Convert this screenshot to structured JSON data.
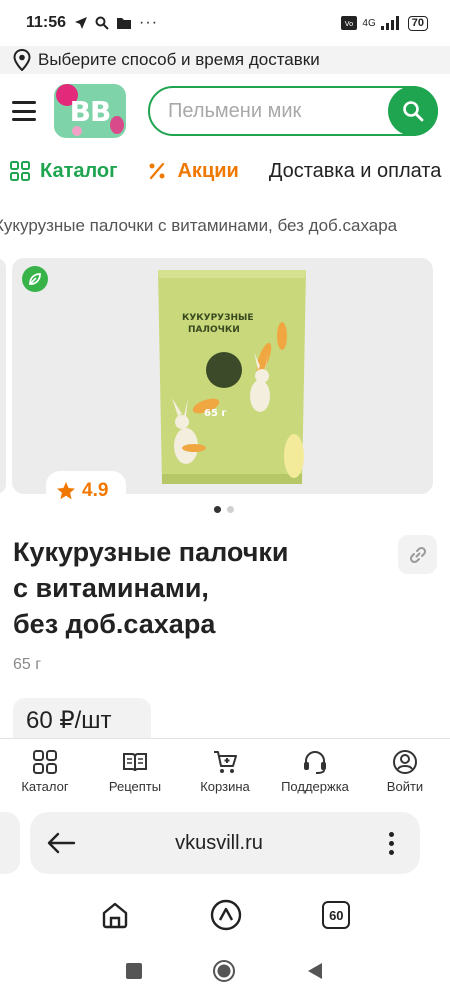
{
  "status_bar": {
    "time": "11:56",
    "network": "4G",
    "battery": "70"
  },
  "delivery_bar": {
    "text": "Выберите способ и время доставки"
  },
  "header": {
    "logo_text": "ВВ",
    "search_placeholder": "Пельмени мик"
  },
  "nav": {
    "items": [
      {
        "label": "Каталог",
        "icon": "grid-icon"
      },
      {
        "label": "Акции",
        "icon": "percent-icon"
      },
      {
        "label": "Доставка и оплата",
        "icon": ""
      }
    ]
  },
  "breadcrumb": "Кукурузные палочки с витаминами, без доб.сахара",
  "product": {
    "package_text": {
      "line1": "КУКУРУЗНЫЕ",
      "line2": "ПАЛОЧКИ",
      "weight": "65 г"
    },
    "rating": "4.9",
    "title": "Кукурузные палочки\nс витаминами,\nбез доб.сахара",
    "weight": "65 г",
    "price": "60 ₽/шт",
    "gallery_count": 2,
    "gallery_active": 1
  },
  "bottom_nav": {
    "items": [
      {
        "label": "Каталог",
        "icon": "grid-icon"
      },
      {
        "label": "Рецепты",
        "icon": "book-icon"
      },
      {
        "label": "Корзина",
        "icon": "cart-icon"
      },
      {
        "label": "Поддержка",
        "icon": "headset-icon"
      },
      {
        "label": "Войти",
        "icon": "user-icon"
      }
    ]
  },
  "browser": {
    "url": "vkusvill.ru",
    "tabs_count": "60"
  },
  "colors": {
    "brand_green": "#1fa54f",
    "promo_orange": "#f07800",
    "logo_mint": "#7fd3a9",
    "logo_pink": "#e2297a"
  }
}
